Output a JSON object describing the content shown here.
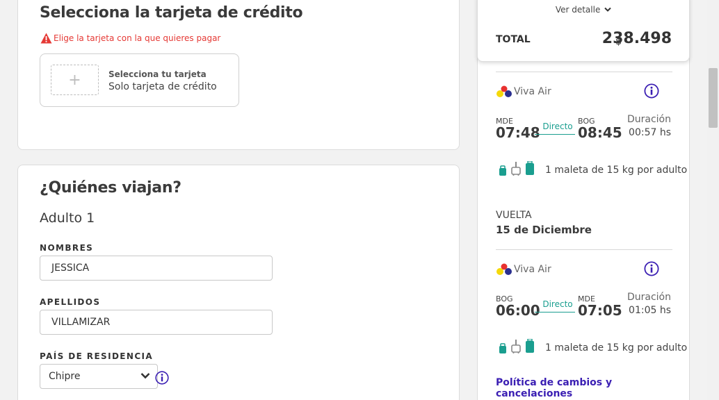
{
  "payment": {
    "title": "Selecciona la tarjeta de crédito",
    "warning": "Elige la tarjeta con la que quieres pagar",
    "card_select_title": "Selecciona tu tarjeta",
    "card_select_subtitle": "Solo tarjeta de crédito",
    "plus": "+"
  },
  "travelers": {
    "title": "¿Quiénes viajan?",
    "adult_label": "Adulto 1",
    "nombres_label": "NOMBRES",
    "nombres_value": "JESSICA",
    "apellidos_label": "APELLIDOS",
    "apellidos_value": "VILLAMIZAR",
    "pais_label": "PAÍS DE RESIDENCIA",
    "pais_value": "Chipre"
  },
  "summary": {
    "ver_detalle": "Ver detalle",
    "total_label": "TOTAL",
    "currency": "$",
    "total_value": "238.498"
  },
  "flights": [
    {
      "airline": "Viva Air",
      "origin_code": "MDE",
      "origin_time": "07:48",
      "type": "Directo",
      "dest_code": "BOG",
      "dest_time": "08:45",
      "duration_label": "Duración",
      "duration": "00:57 hs",
      "baggage": "1 maleta de 15 kg por adulto"
    },
    {
      "airline": "Viva Air",
      "origin_code": "BOG",
      "origin_time": "06:00",
      "type": "Directo",
      "dest_code": "MDE",
      "dest_time": "07:05",
      "duration_label": "Duración",
      "duration": "01:05 hs",
      "baggage": "1 maleta de 15 kg por adulto"
    }
  ],
  "vuelta": {
    "label": "VUELTA",
    "date": "15 de Diciembre"
  },
  "policy_link": "Política de cambios y cancelaciones",
  "colors": {
    "accent_teal": "#1a9e8f",
    "link_purple": "#3b1fb3",
    "error_red": "#e53935"
  },
  "icons": {
    "warning": "warning-icon",
    "info": "info-icon",
    "chevron": "chevron-down-icon",
    "airline_logo": "viva-air-logo-icon",
    "bags": [
      "personal-item-icon",
      "carry-on-icon",
      "checked-bag-icon"
    ]
  }
}
